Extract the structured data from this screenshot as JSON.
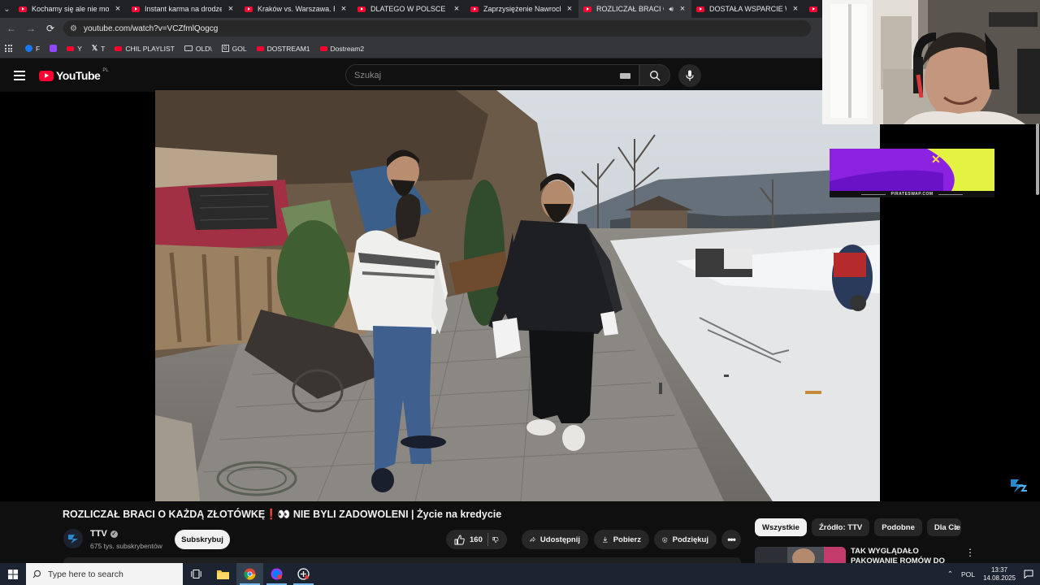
{
  "browser": {
    "tabs": [
      {
        "title": "Kochamy się ale nie może"
      },
      {
        "title": "Instant karma na drodze"
      },
      {
        "title": "Kraków vs. Warszawa. Róż"
      },
      {
        "title": "DLATEGO W POLSCE NIC"
      },
      {
        "title": "Zaprzysiężenie Nawrockie"
      },
      {
        "title": "ROZLICZAŁ BRACI O K"
      },
      {
        "title": "DOSTAŁA WSPARCIE W P"
      }
    ],
    "active_tab_index": 5,
    "url": "youtube.com/watch?v=VCZfmlQogcg",
    "bookmarks": [
      {
        "label": "F",
        "icon": "facebook-icon"
      },
      {
        "label": "",
        "icon": "twitch-icon"
      },
      {
        "label": "Y",
        "icon": "youtube-icon"
      },
      {
        "label": "T",
        "icon": "x-icon"
      },
      {
        "label": "CHIL PLAYLIST",
        "icon": "youtube-icon"
      },
      {
        "label": "OLD\\",
        "icon": "folder-icon"
      },
      {
        "label": "GOL",
        "icon": "g-icon"
      },
      {
        "label": "DOSTREAM1",
        "icon": "youtube-icon"
      },
      {
        "label": "Dostream2",
        "icon": "youtube-icon"
      }
    ]
  },
  "youtube": {
    "logo_text": "YouTube",
    "country_code": "PL",
    "search_placeholder": "Szukaj",
    "video": {
      "title": "ROZLICZAŁ BRACI O KAŻDĄ ZŁOTÓWKĘ❗👀 NIE BYLI ZADOWOLENI | Życie na kredycie",
      "channel_name": "TTV",
      "subscribers": "675 tys. subskrybentów",
      "subscribe_label": "Subskrybuj",
      "likes": "160",
      "share_label": "Udostępnij",
      "download_label": "Pobierz",
      "thanks_label": "Podziękuj"
    },
    "chips": [
      {
        "label": "Wszystkie",
        "active": true
      },
      {
        "label": "Źródło: TTV",
        "active": false
      },
      {
        "label": "Podobne",
        "active": false
      },
      {
        "label": "Dla Cie",
        "active": false
      }
    ],
    "recommended": [
      {
        "title": "TAK WYGLĄDAŁO PAKOWANIE ROMÓW DO PRACY ZA"
      }
    ]
  },
  "overlay": {
    "ad_text": "PIRATESWAP.COM"
  },
  "taskbar": {
    "search_placeholder": "Type here to search",
    "language": "POL",
    "time": "13:37",
    "date": "14.08.2025"
  },
  "colors": {
    "youtube_red": "#ff0033",
    "page_bg": "#0f0f0f",
    "ad_purple": "#8a22e0",
    "ad_yellow": "#e4f241"
  }
}
